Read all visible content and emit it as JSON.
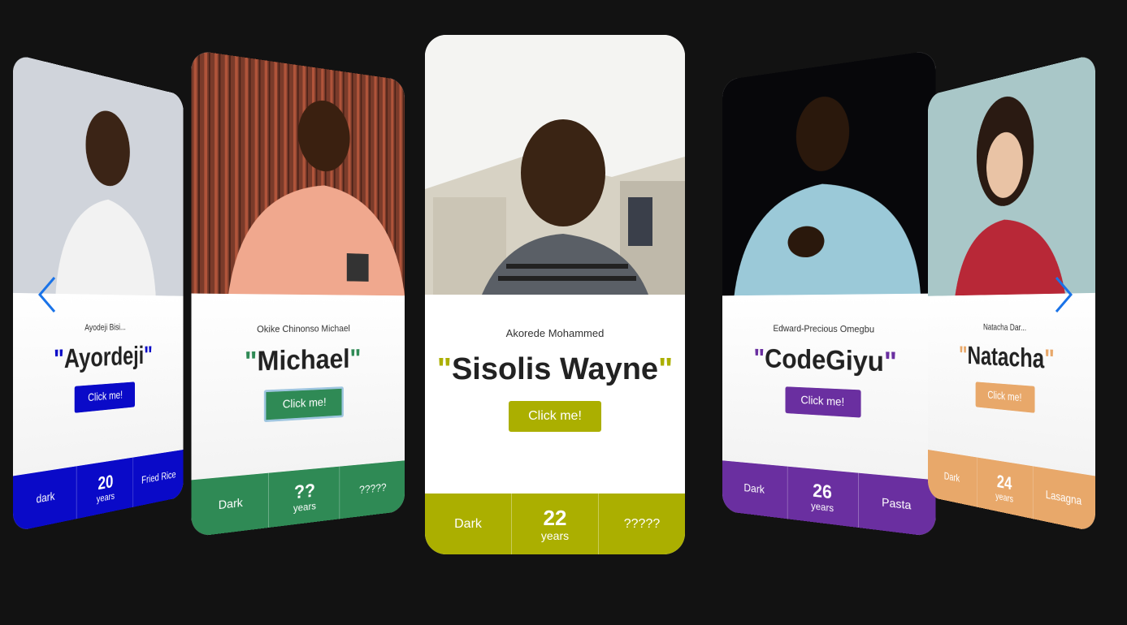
{
  "colors": {
    "background": "#121212",
    "accent_blue": "#1a73e8"
  },
  "navigation": {
    "prev_icon": "chevron-left-icon",
    "next_icon": "chevron-right-icon"
  },
  "cards": [
    {
      "full_name": "Ayodeji Bisi...",
      "nickname": "Ayordeji",
      "button_label": "Click me!",
      "accent": "#0a0ac8",
      "stats": {
        "left": "dark",
        "age": "20",
        "age_unit": "years",
        "right": "Fried Rice"
      }
    },
    {
      "full_name": "Okike Chinonso Michael",
      "nickname": "Michael",
      "button_label": "Click me!",
      "accent": "#2f8a55",
      "stats": {
        "left": "Dark",
        "age": "??",
        "age_unit": "years",
        "right": "?????"
      }
    },
    {
      "full_name": "Akorede Mohammed",
      "nickname": "Sisolis Wayne",
      "button_label": "Click me!",
      "accent": "#abaf00",
      "stats": {
        "left": "Dark",
        "age": "22",
        "age_unit": "years",
        "right": "?????"
      }
    },
    {
      "full_name": "Edward-Precious Omegbu",
      "nickname": "CodeGiyu",
      "button_label": "Click me!",
      "accent": "#6a2fa0",
      "stats": {
        "left": "Dark",
        "age": "26",
        "age_unit": "years",
        "right": "Pasta"
      }
    },
    {
      "full_name": "Natacha Dar...",
      "nickname": "Natacha",
      "button_label": "Click me!",
      "accent": "#e8a86a",
      "stats": {
        "left": "Dark",
        "age": "24",
        "age_unit": "years",
        "right": "Lasagna"
      }
    }
  ]
}
